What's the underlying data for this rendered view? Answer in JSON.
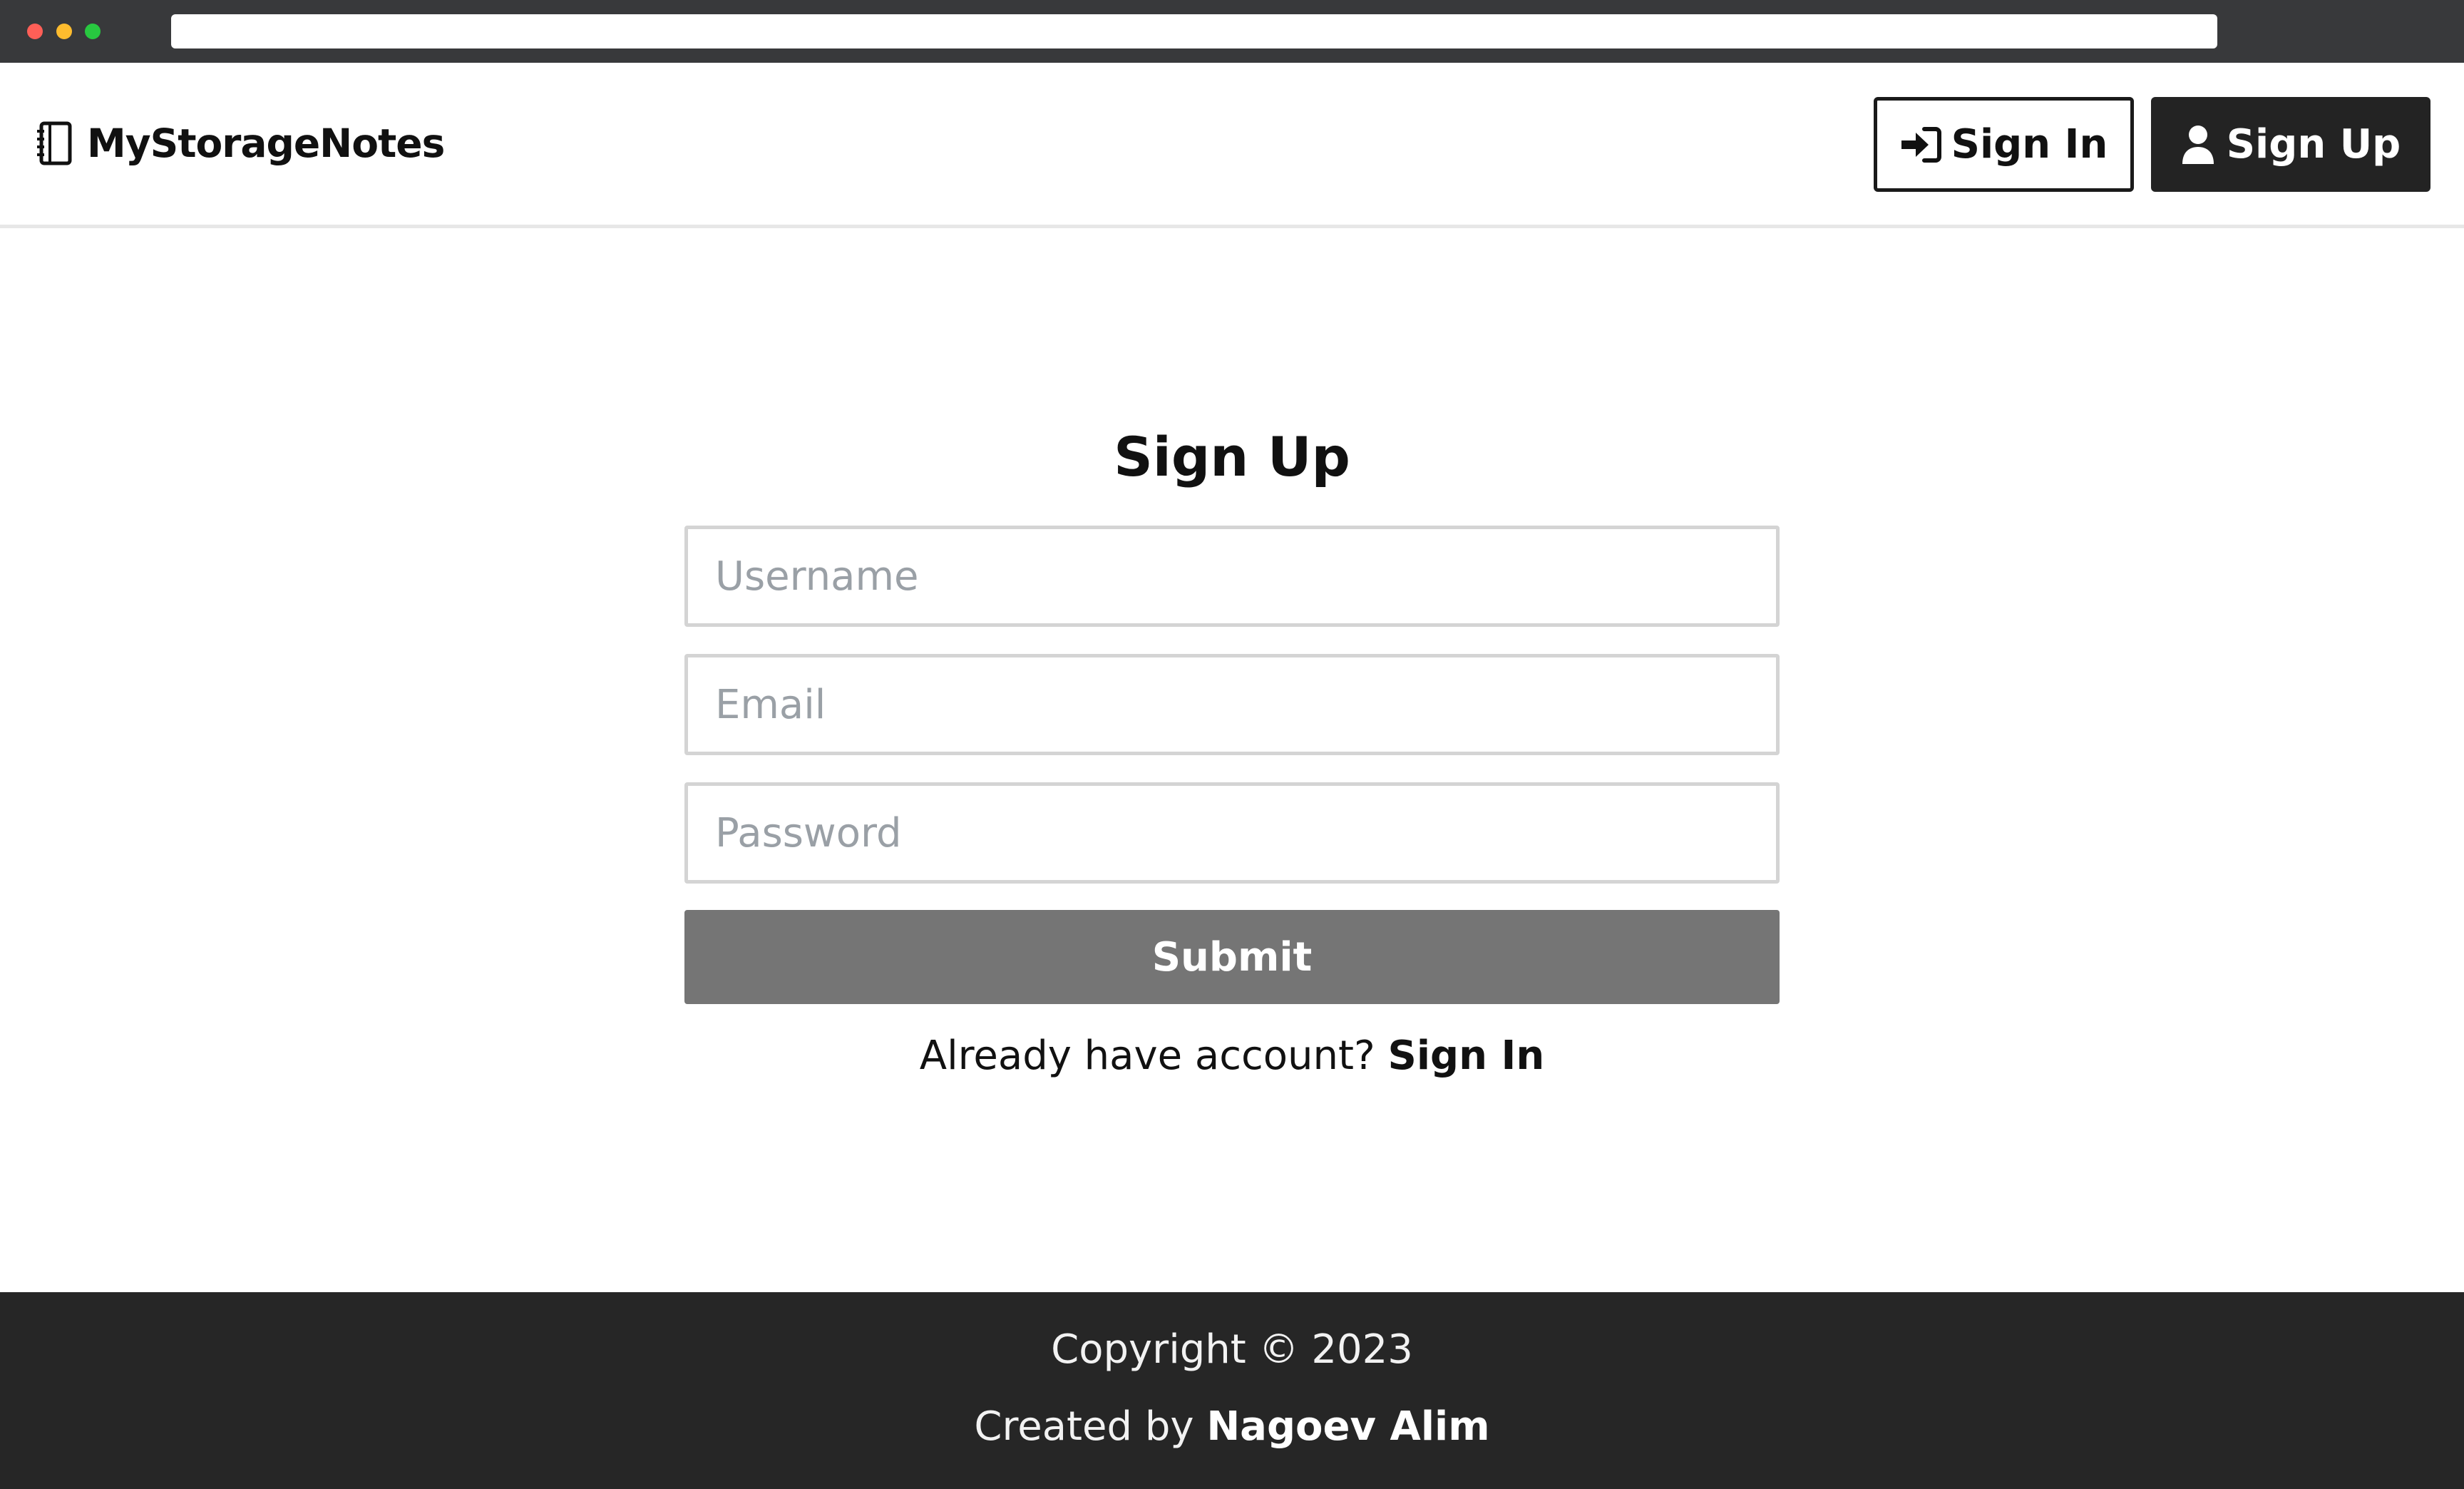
{
  "header": {
    "brand": "MyStorageNotes",
    "brand_icon": "notebook-icon",
    "signin_label": "Sign In",
    "signin_icon": "sign-in-icon",
    "signup_label": "Sign Up",
    "signup_icon": "user-icon"
  },
  "form": {
    "title": "Sign Up",
    "username_placeholder": "Username",
    "username_value": "",
    "email_placeholder": "Email",
    "email_value": "",
    "password_placeholder": "Password",
    "password_value": "",
    "submit_label": "Submit",
    "already_text": "Already have account?",
    "signin_link": "Sign In"
  },
  "footer": {
    "copyright": "Copyright © 2023",
    "created_prefix": "Created by",
    "author": "Nagoev Alim"
  },
  "colors": {
    "chrome": "#38393b",
    "primary_dark": "#232323",
    "submit_gray": "#757575",
    "footer_bg": "#262626"
  }
}
